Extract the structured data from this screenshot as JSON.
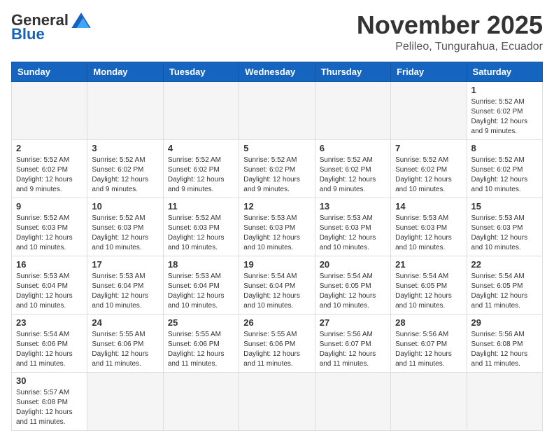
{
  "logo": {
    "general": "General",
    "blue": "Blue"
  },
  "title": {
    "month": "November 2025",
    "location": "Pelileo, Tungurahua, Ecuador"
  },
  "weekdays": [
    "Sunday",
    "Monday",
    "Tuesday",
    "Wednesday",
    "Thursday",
    "Friday",
    "Saturday"
  ],
  "days": {
    "1": {
      "sunrise": "5:52 AM",
      "sunset": "6:02 PM",
      "daylight": "12 hours and 9 minutes."
    },
    "2": {
      "sunrise": "5:52 AM",
      "sunset": "6:02 PM",
      "daylight": "12 hours and 9 minutes."
    },
    "3": {
      "sunrise": "5:52 AM",
      "sunset": "6:02 PM",
      "daylight": "12 hours and 9 minutes."
    },
    "4": {
      "sunrise": "5:52 AM",
      "sunset": "6:02 PM",
      "daylight": "12 hours and 9 minutes."
    },
    "5": {
      "sunrise": "5:52 AM",
      "sunset": "6:02 PM",
      "daylight": "12 hours and 9 minutes."
    },
    "6": {
      "sunrise": "5:52 AM",
      "sunset": "6:02 PM",
      "daylight": "12 hours and 9 minutes."
    },
    "7": {
      "sunrise": "5:52 AM",
      "sunset": "6:02 PM",
      "daylight": "12 hours and 10 minutes."
    },
    "8": {
      "sunrise": "5:52 AM",
      "sunset": "6:02 PM",
      "daylight": "12 hours and 10 minutes."
    },
    "9": {
      "sunrise": "5:52 AM",
      "sunset": "6:03 PM",
      "daylight": "12 hours and 10 minutes."
    },
    "10": {
      "sunrise": "5:52 AM",
      "sunset": "6:03 PM",
      "daylight": "12 hours and 10 minutes."
    },
    "11": {
      "sunrise": "5:52 AM",
      "sunset": "6:03 PM",
      "daylight": "12 hours and 10 minutes."
    },
    "12": {
      "sunrise": "5:53 AM",
      "sunset": "6:03 PM",
      "daylight": "12 hours and 10 minutes."
    },
    "13": {
      "sunrise": "5:53 AM",
      "sunset": "6:03 PM",
      "daylight": "12 hours and 10 minutes."
    },
    "14": {
      "sunrise": "5:53 AM",
      "sunset": "6:03 PM",
      "daylight": "12 hours and 10 minutes."
    },
    "15": {
      "sunrise": "5:53 AM",
      "sunset": "6:03 PM",
      "daylight": "12 hours and 10 minutes."
    },
    "16": {
      "sunrise": "5:53 AM",
      "sunset": "6:04 PM",
      "daylight": "12 hours and 10 minutes."
    },
    "17": {
      "sunrise": "5:53 AM",
      "sunset": "6:04 PM",
      "daylight": "12 hours and 10 minutes."
    },
    "18": {
      "sunrise": "5:53 AM",
      "sunset": "6:04 PM",
      "daylight": "12 hours and 10 minutes."
    },
    "19": {
      "sunrise": "5:54 AM",
      "sunset": "6:04 PM",
      "daylight": "12 hours and 10 minutes."
    },
    "20": {
      "sunrise": "5:54 AM",
      "sunset": "6:05 PM",
      "daylight": "12 hours and 10 minutes."
    },
    "21": {
      "sunrise": "5:54 AM",
      "sunset": "6:05 PM",
      "daylight": "12 hours and 10 minutes."
    },
    "22": {
      "sunrise": "5:54 AM",
      "sunset": "6:05 PM",
      "daylight": "12 hours and 11 minutes."
    },
    "23": {
      "sunrise": "5:54 AM",
      "sunset": "6:06 PM",
      "daylight": "12 hours and 11 minutes."
    },
    "24": {
      "sunrise": "5:55 AM",
      "sunset": "6:06 PM",
      "daylight": "12 hours and 11 minutes."
    },
    "25": {
      "sunrise": "5:55 AM",
      "sunset": "6:06 PM",
      "daylight": "12 hours and 11 minutes."
    },
    "26": {
      "sunrise": "5:55 AM",
      "sunset": "6:06 PM",
      "daylight": "12 hours and 11 minutes."
    },
    "27": {
      "sunrise": "5:56 AM",
      "sunset": "6:07 PM",
      "daylight": "12 hours and 11 minutes."
    },
    "28": {
      "sunrise": "5:56 AM",
      "sunset": "6:07 PM",
      "daylight": "12 hours and 11 minutes."
    },
    "29": {
      "sunrise": "5:56 AM",
      "sunset": "6:08 PM",
      "daylight": "12 hours and 11 minutes."
    },
    "30": {
      "sunrise": "5:57 AM",
      "sunset": "6:08 PM",
      "daylight": "12 hours and 11 minutes."
    }
  }
}
